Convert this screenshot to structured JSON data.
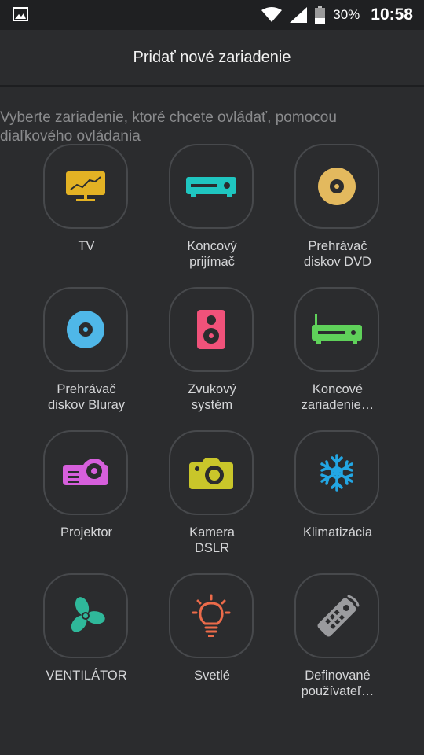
{
  "status_bar": {
    "battery_percent": "30%",
    "time": "10:58",
    "icons": [
      "image-icon",
      "wifi-icon",
      "signal-icon",
      "battery-icon"
    ]
  },
  "header": {
    "title": "Pridať nové zariadenie"
  },
  "subtitle": "Vyberte zariadenie, ktoré chcete ovládať, pomocou diaľkového ovládania",
  "devices": [
    {
      "label": "TV",
      "icon": "tv-icon",
      "color": "#e3b224"
    },
    {
      "label": "Koncový\nprijímač",
      "icon": "set-top-box-icon",
      "color": "#1fc6c0"
    },
    {
      "label": "Prehrávač\ndiskov DVD",
      "icon": "dvd-disc-icon",
      "color": "#e3b95e"
    },
    {
      "label": "Prehrávač\ndiskov Bluray",
      "icon": "bluray-disc-icon",
      "color": "#4fb7e8"
    },
    {
      "label": "Zvukový\nsystém",
      "icon": "speaker-icon",
      "color": "#f0527a"
    },
    {
      "label": "Koncové\nzariadenie…",
      "icon": "router-icon",
      "color": "#5fd15a"
    },
    {
      "label": "Projektor",
      "icon": "projector-icon",
      "color": "#d65fdc"
    },
    {
      "label": "Kamera\nDSLR",
      "icon": "camera-icon",
      "color": "#c9c62a"
    },
    {
      "label": "Klimatizácia",
      "icon": "snowflake-icon",
      "color": "#23a6e3"
    },
    {
      "label": "VENTILÁTOR",
      "icon": "fan-icon",
      "color": "#2fb89a"
    },
    {
      "label": "Svetlé",
      "icon": "light-bulb-icon",
      "color": "#ec6b4a"
    },
    {
      "label": "Definované\npoužívateľ…",
      "icon": "remote-icon",
      "color": "#9a9b9e"
    }
  ]
}
